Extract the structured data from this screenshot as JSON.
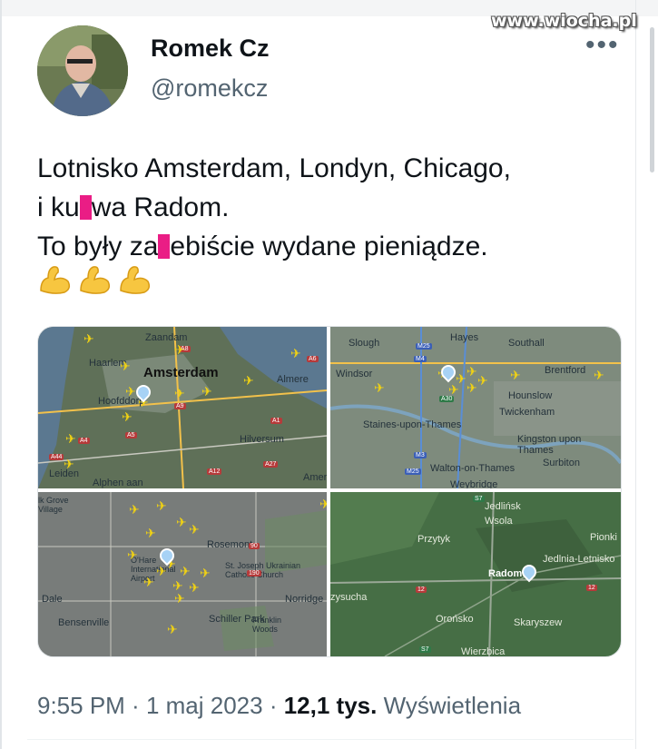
{
  "watermark": "www.wiocha.pl",
  "author": {
    "name": "Romek Cz",
    "handle": "@romekcz"
  },
  "menu_icon": "more-horizontal-icon",
  "tweet": {
    "line1": "Lotnisko Amsterdam, Londyn, Chicago,",
    "line2a": "i ku",
    "line2b": "wa Radom.",
    "line3a": "To były za",
    "line3b": "ebiście wydane pieniądze.",
    "emoji": [
      "💪",
      "💪",
      "💪"
    ],
    "censor_color": "#ea1d85"
  },
  "maps": [
    {
      "labels": [
        "Zaandam",
        "Haarlem",
        "Amsterdam",
        "Almere",
        "Hoofddorp",
        "Hilversum",
        "Leiden",
        "Alphen aan",
        "Amer"
      ],
      "roads": [
        "A8",
        "A9",
        "A1",
        "A6",
        "A27",
        "A4",
        "A12",
        "A44",
        "A5"
      ]
    },
    {
      "labels": [
        "Hayes",
        "Southall",
        "Slough",
        "Windsor",
        "Brentford",
        "Hounslow",
        "Twickenham",
        "Staines-upon-Thames",
        "Kingston upon Thames",
        "Surbiton",
        "Walton-on-Thames",
        "Weybridge"
      ],
      "roads": [
        "M4",
        "M25",
        "A30",
        "M3",
        "M25"
      ]
    },
    {
      "labels": [
        "lk Grove Village",
        "Rosemont",
        "O'Hare International Airport",
        "St. Joseph Ukrainian Catholic Church",
        "Norridge",
        "Dale",
        "Bensenville",
        "Schiller Park",
        "Franklin Woods"
      ],
      "roads": [
        "90",
        "190"
      ]
    },
    {
      "labels": [
        "Jedlińsk",
        "Wsola",
        "Przytyk",
        "Radom",
        "Jedlnia-Letnisko",
        "Pionki",
        "zysucha",
        "Orońsko",
        "Skaryszew",
        "Wierzbica"
      ],
      "roads": [
        "S7",
        "12",
        "12",
        "S7"
      ]
    }
  ],
  "footer": {
    "time": "9:55 PM",
    "sep1": " · ",
    "date": "1 maj 2023",
    "sep2": " · ",
    "views": "12,1 tys.",
    "views_label": " Wyświetlenia"
  }
}
